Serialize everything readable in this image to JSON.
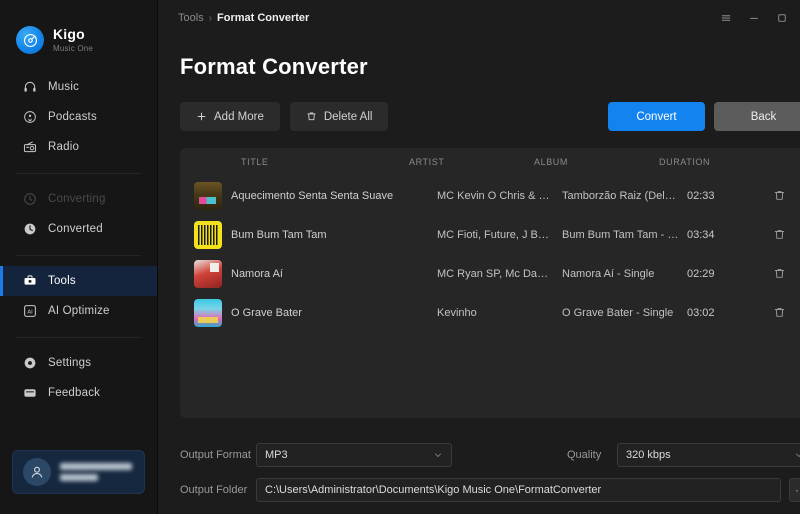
{
  "brand": {
    "name": "Kigo",
    "subtitle": "Music One",
    "logo_icon": "compass-music-icon",
    "accent_color": "#1383f0"
  },
  "sidebar": {
    "items": [
      {
        "label": "Music",
        "icon": "headphones-icon",
        "state": "normal"
      },
      {
        "label": "Podcasts",
        "icon": "podcast-icon",
        "state": "normal"
      },
      {
        "label": "Radio",
        "icon": "radio-icon",
        "state": "normal"
      },
      {
        "label": "Converting",
        "icon": "spinner-icon",
        "state": "disabled"
      },
      {
        "label": "Converted",
        "icon": "clock-icon",
        "state": "normal"
      },
      {
        "label": "Tools",
        "icon": "toolbox-icon",
        "state": "active"
      },
      {
        "label": "AI Optimize",
        "icon": "ai-badge-icon",
        "state": "normal"
      },
      {
        "label": "Settings",
        "icon": "gear-icon",
        "state": "normal"
      },
      {
        "label": "Feedback",
        "icon": "message-icon",
        "state": "normal"
      }
    ],
    "user": {
      "avatar_icon": "user-avatar-icon",
      "name_redacted": true
    }
  },
  "titlebar": {
    "breadcrumb_parent": "Tools",
    "breadcrumb_separator": "›",
    "breadcrumb_current": "Format Converter",
    "controls": [
      {
        "name": "menu-button",
        "icon": "hamburger-icon"
      },
      {
        "name": "minimize-button",
        "icon": "minimize-icon"
      },
      {
        "name": "maximize-button",
        "icon": "maximize-icon"
      },
      {
        "name": "close-button",
        "icon": "close-icon"
      }
    ]
  },
  "page": {
    "title": "Format Converter"
  },
  "toolbar": {
    "add_more_label": "Add More",
    "add_more_icon": "plus-icon",
    "delete_all_label": "Delete All",
    "delete_all_icon": "trash-icon",
    "convert_label": "Convert",
    "back_label": "Back"
  },
  "table": {
    "headers": [
      "TITLE",
      "ARTIST",
      "ALBUM",
      "DURATION"
    ],
    "delete_row_icon": "trash-icon",
    "rows": [
      {
        "art": "a1",
        "title": "Aquecimento Senta Senta Suave",
        "artist": "MC Kevin O Chris & BU...",
        "album": "Tamborzão Raiz (Deluxe)",
        "duration": "02:33"
      },
      {
        "art": "a2",
        "title": "Bum Bum Tam Tam",
        "artist": "MC Fioti, Future, J Balvi...",
        "album": "Bum Bum Tam Tam - Si...",
        "duration": "03:34"
      },
      {
        "art": "a3",
        "title": "Namora Aí",
        "artist": "MC Ryan SP, Mc DanieL...",
        "album": "Namora Aí - Single",
        "duration": "02:29"
      },
      {
        "art": "a4",
        "title": "O Grave Bater",
        "artist": "Kevinho",
        "album": "O Grave Bater - Single",
        "duration": "03:02"
      }
    ]
  },
  "settings": {
    "output_format_label": "Output Format",
    "output_format_value": "MP3",
    "quality_label": "Quality",
    "quality_value": "320 kbps",
    "output_folder_label": "Output Folder",
    "output_folder_value": "C:\\Users\\Administrator\\Documents\\Kigo Music One\\FormatConverter",
    "browse_label": "···"
  }
}
